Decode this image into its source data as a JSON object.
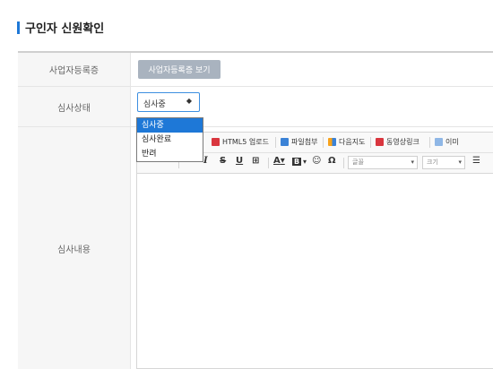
{
  "page": {
    "title": "구인자 신원확인"
  },
  "rows": {
    "business_reg": {
      "label": "사업자등록증",
      "button": "사업자등록증 보기"
    },
    "status": {
      "label": "심사상태",
      "selected": "심사중",
      "options": [
        "심사중",
        "심사완료",
        "반려"
      ]
    },
    "content": {
      "label": "심사내용"
    }
  },
  "editor": {
    "toolbar1": {
      "html5_upload": "HTML5 업로드",
      "file_attach": "파일첨부",
      "daum_map": "다음지도",
      "video_link": "동영상링크",
      "image_partial": "이미"
    },
    "toolbar2": {
      "italic": "I",
      "strike": "S",
      "underline": "U",
      "font_color": "A",
      "bg_color": "B",
      "font": "글꼴",
      "size": "크기"
    }
  },
  "colors": {
    "accent": "#1e78d7",
    "button_bg": "#a9b3bf",
    "label_bg": "#f6f6f6"
  }
}
